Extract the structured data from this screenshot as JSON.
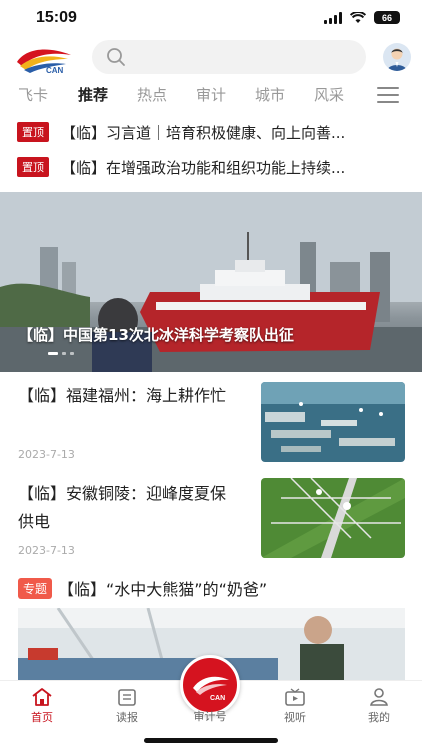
{
  "status_bar": {
    "time": "15:09",
    "battery": "66"
  },
  "header": {
    "logo_text": "CAN"
  },
  "tabs": [
    "飞卡",
    "推荐",
    "热点",
    "审计",
    "城市",
    "风采"
  ],
  "active_tab": 1,
  "pinned": [
    {
      "badge": "置顶",
      "text": "【临】习言道｜培育积极健康、向上向善..."
    },
    {
      "badge": "置顶",
      "text": "【临】在增强政治功能和组织功能上持续..."
    }
  ],
  "hero": {
    "title": "【临】中国第13次北冰洋科学考察队出征"
  },
  "articles": [
    {
      "title": "【临】福建福州：海上耕作忙",
      "date": "2023-7-13"
    },
    {
      "title": "【临】安徽铜陵：迎峰度夏保供电",
      "date": "2023-7-13"
    }
  ],
  "special": {
    "badge": "专题",
    "title": "【临】“水中大熊猫”的“奶爸”"
  },
  "tabbar": {
    "items": [
      "首页",
      "读报",
      "审计号",
      "视听",
      "我的"
    ],
    "center_logo_text": "CAN"
  },
  "colors": {
    "brand_red": "#c8141e",
    "special_badge": "#f05a4a"
  }
}
